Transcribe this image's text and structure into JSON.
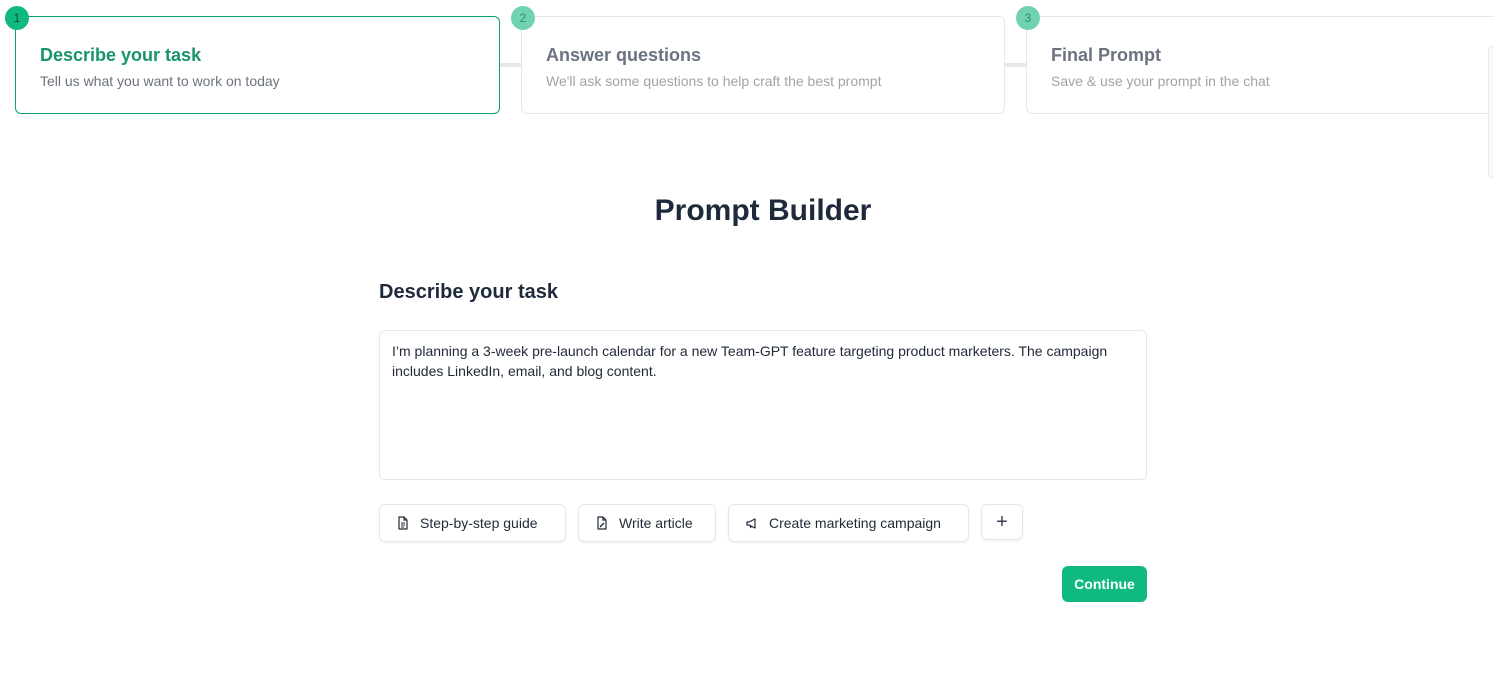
{
  "stepper": {
    "steps": [
      {
        "number": "1",
        "title": "Describe your task",
        "subtitle": "Tell us what you want to work on today",
        "active": true
      },
      {
        "number": "2",
        "title": "Answer questions",
        "subtitle": "We'll ask some questions to help craft the best prompt",
        "active": false
      },
      {
        "number": "3",
        "title": "Final Prompt",
        "subtitle": "Save & use your prompt in the chat",
        "active": false
      }
    ]
  },
  "main": {
    "title": "Prompt Builder",
    "section_label": "Describe your task",
    "task_value": "I’m planning a 3-week pre-launch calendar for a new Team-GPT feature targeting product marketers. The campaign includes LinkedIn, email, and blog content.",
    "templates": [
      {
        "label": "Step-by-step guide",
        "icon": "document-icon"
      },
      {
        "label": "Write article",
        "icon": "file-edit-icon"
      },
      {
        "label": "Create marketing campaign",
        "icon": "megaphone-icon"
      }
    ],
    "add_label": "+",
    "continue_label": "Continue"
  },
  "colors": {
    "accent": "#10b981",
    "accent_text": "#17946e",
    "border": "#e5e7eb"
  }
}
